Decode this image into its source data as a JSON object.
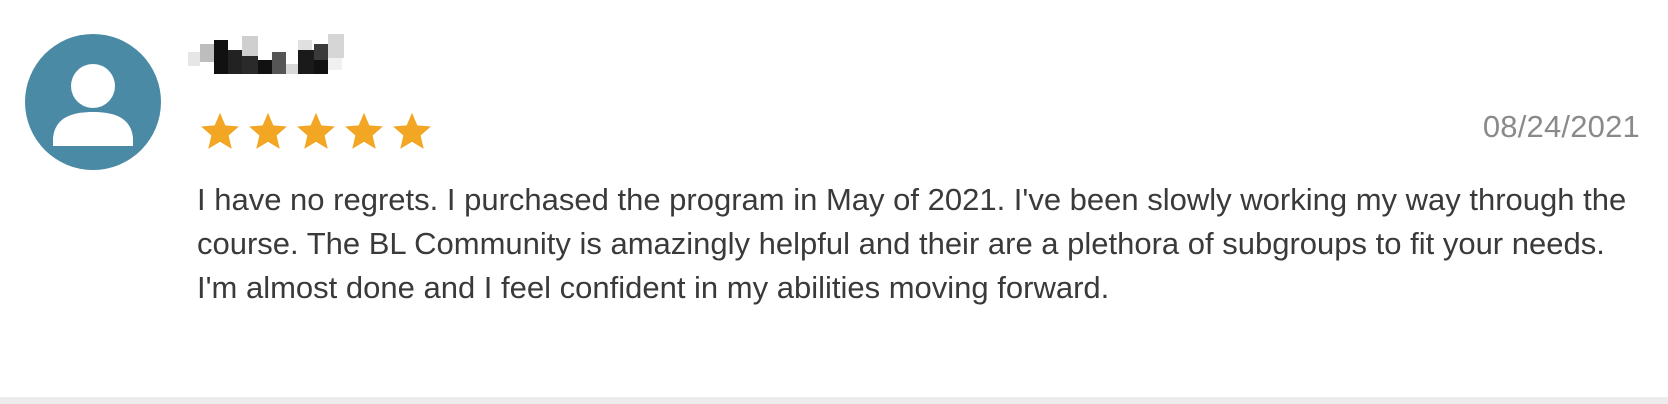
{
  "review": {
    "avatar_icon": "user-avatar-icon",
    "avatar_color": "#4a8aa5",
    "reviewer_name_redacted": true,
    "rating": 5,
    "rating_max": 5,
    "star_icon": "star-icon",
    "star_color": "#f2a623",
    "date": "08/24/2021",
    "text": "I have no regrets. I purchased the program in May of 2021. I've been slowly working my way through the course. The BL Community is amazingly helpful and their are a plethora of subgroups to fit your needs. I'm almost done and I feel confident in my abilities moving forward."
  }
}
